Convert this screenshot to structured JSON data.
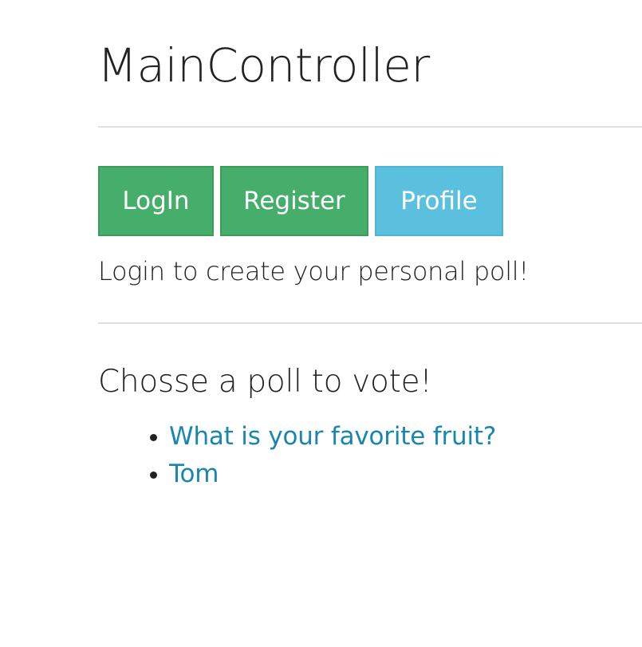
{
  "header": {
    "title": "MainController"
  },
  "auth_buttons": {
    "login_label": "LogIn",
    "register_label": "Register",
    "profile_label": "Profile"
  },
  "login_hint": "Login to create your personal poll!",
  "polls": {
    "heading": "Chosse a poll to vote!",
    "items": [
      {
        "label": "What is your favorite fruit?"
      },
      {
        "label": "Tom"
      }
    ]
  },
  "colors": {
    "success_button": "#45ae6a",
    "info_button": "#5bc0de",
    "link": "#1a86b0",
    "divider": "#e0e0e0"
  }
}
